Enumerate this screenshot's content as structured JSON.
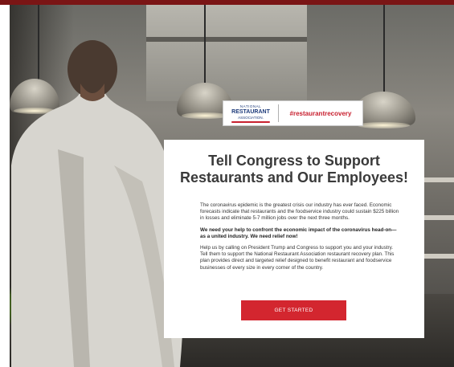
{
  "colors": {
    "top_bar": "#7a1515",
    "brand_blue": "#1d3a7a",
    "accent_red": "#c8202f",
    "cta_red": "#d3262f",
    "title_text": "#3a3a3a"
  },
  "logo": {
    "line1": "NATIONAL",
    "line2": "RESTAURANT",
    "line3": "ASSOCIATION.",
    "hashtag": "#restaurantrecovery"
  },
  "card": {
    "title_line1": "Tell Congress to Support",
    "title_line2": "Restaurants and Our Employees!",
    "paragraph1": "The coronavirus epidemic is the greatest crisis our industry has ever faced.  Economic forecasts indicate that restaurants and the foodservice industry could sustain $225 billion in losses and eliminate 5-7 million jobs over the next three months.",
    "paragraph2": "We need your help to confront the economic impact of the coronavirus head-on—as a united industry.  We need relief now!",
    "paragraph3": "Help us by calling on President Trump and Congress to support you and your industry.  Tell them to support the National Restaurant Association restaurant recovery plan.  This plan provides direct and targeted relief designed to benefit restaurant and foodservice businesses of every size in every corner of the country.",
    "cta_label": "GET STARTED"
  }
}
